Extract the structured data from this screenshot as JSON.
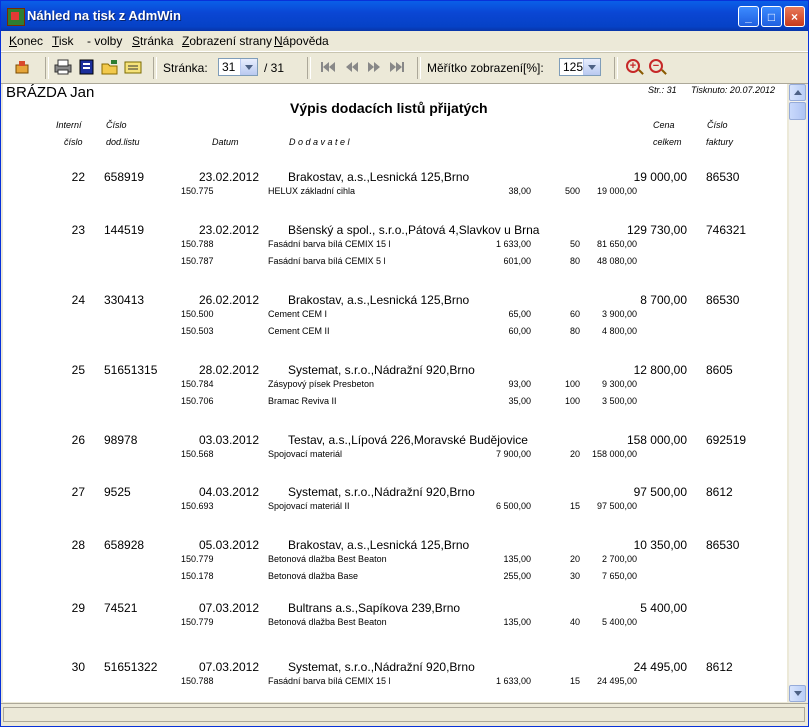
{
  "window": {
    "title": "Náhled na tisk z AdmWin"
  },
  "menu": [
    {
      "label": "Konec"
    },
    {
      "label": "Tisk"
    },
    {
      "label": "- volby"
    },
    {
      "label": "Stránka"
    },
    {
      "label": "Zobrazení strany"
    },
    {
      "label": "Nápověda"
    }
  ],
  "toolbar": {
    "page_label": "Stránka:",
    "page_value": "31",
    "page_total": "/ 31",
    "scale_label": "Měřítko zobrazení[%]:",
    "scale_value": "125"
  },
  "report": {
    "company": "BRÁZDA Jan",
    "page_info": "Str.: 31",
    "print_info": "Tisknuto: 20.07.2012",
    "title": "Výpis dodacích listů přijatých",
    "headers": {
      "int1": "Interní",
      "int2": "číslo",
      "dl1": "Číslo",
      "dl2": "dod.listu",
      "date": "Datum",
      "supplier": "D o d a v a t e l",
      "cena1": "Cena",
      "cena2": "celkem",
      "fa1": "Číslo",
      "fa2": "faktury"
    },
    "entries": [
      {
        "num": "22",
        "dl": "658919",
        "date": "23.02.2012",
        "supplier": "Brakostav, a.s.,Lesnická 125,Brno",
        "total": "19 000,00",
        "invoice": "86530",
        "items": [
          {
            "code": "150.775",
            "name": "HELUX základní cihla",
            "price": "38,00",
            "qty": "500",
            "sum": "19 000,00"
          }
        ]
      },
      {
        "num": "23",
        "dl": "144519",
        "date": "23.02.2012",
        "supplier": "Bšenský a spol., s.r.o.,Pátová 4,Slavkov u Brna",
        "total": "129 730,00",
        "invoice": "746321",
        "items": [
          {
            "code": "150.788",
            "name": "Fasádní barva bílá CEMIX 15 l",
            "price": "1 633,00",
            "qty": "50",
            "sum": "81 650,00"
          },
          {
            "code": "150.787",
            "name": "Fasádní barva bílá CEMIX 5 l",
            "price": "601,00",
            "qty": "80",
            "sum": "48 080,00"
          }
        ]
      },
      {
        "num": "24",
        "dl": "330413",
        "date": "26.02.2012",
        "supplier": "Brakostav, a.s.,Lesnická 125,Brno",
        "total": "8 700,00",
        "invoice": "86530",
        "items": [
          {
            "code": "150.500",
            "name": "Cement CEM I",
            "price": "65,00",
            "qty": "60",
            "sum": "3 900,00"
          },
          {
            "code": "150.503",
            "name": "Cement CEM II",
            "price": "60,00",
            "qty": "80",
            "sum": "4 800,00"
          }
        ]
      },
      {
        "num": "25",
        "dl": "51651315",
        "date": "28.02.2012",
        "supplier": "Systemat, s.r.o.,Nádražní 920,Brno",
        "total": "12 800,00",
        "invoice": "8605",
        "items": [
          {
            "code": "150.784",
            "name": "Zásypový písek Presbeton",
            "price": "93,00",
            "qty": "100",
            "sum": "9 300,00"
          },
          {
            "code": "150.706",
            "name": "Bramac Reviva II",
            "price": "35,00",
            "qty": "100",
            "sum": "3 500,00"
          }
        ]
      },
      {
        "num": "26",
        "dl": "98978",
        "date": "03.03.2012",
        "supplier": "Testav, a.s.,Lípová 226,Moravské Budějovice",
        "total": "158 000,00",
        "invoice": "692519",
        "items": [
          {
            "code": "150.568",
            "name": "Spojovací materiál",
            "price": "7 900,00",
            "qty": "20",
            "sum": "158 000,00"
          }
        ]
      },
      {
        "num": "27",
        "dl": "9525",
        "date": "04.03.2012",
        "supplier": "Systemat, s.r.o.,Nádražní 920,Brno",
        "total": "97 500,00",
        "invoice": "8612",
        "items": [
          {
            "code": "150.693",
            "name": "Spojovací materiál II",
            "price": "6 500,00",
            "qty": "15",
            "sum": "97 500,00"
          }
        ]
      },
      {
        "num": "28",
        "dl": "658928",
        "date": "05.03.2012",
        "supplier": "Brakostav, a.s.,Lesnická 125,Brno",
        "total": "10 350,00",
        "invoice": "86530",
        "items": [
          {
            "code": "150.779",
            "name": "Betonová dlažba Best Beaton",
            "price": "135,00",
            "qty": "20",
            "sum": "2 700,00"
          },
          {
            "code": "150.178",
            "name": "Betonová dlažba Base",
            "price": "255,00",
            "qty": "30",
            "sum": "7 650,00"
          }
        ]
      },
      {
        "num": "29",
        "dl": "74521",
        "date": "07.03.2012",
        "supplier": "Bultrans a.s.,Sapíkova 239,Brno",
        "total": "5 400,00",
        "invoice": "",
        "items": [
          {
            "code": "150.779",
            "name": "Betonová dlažba Best Beaton",
            "price": "135,00",
            "qty": "40",
            "sum": "5 400,00"
          }
        ]
      },
      {
        "num": "30",
        "dl": "51651322",
        "date": "07.03.2012",
        "supplier": "Systemat, s.r.o.,Nádražní 920,Brno",
        "total": "24 495,00",
        "invoice": "8612",
        "items": [
          {
            "code": "150.788",
            "name": "Fasádní barva bílá CEMIX 15 l",
            "price": "1 633,00",
            "qty": "15",
            "sum": "24 495,00"
          }
        ]
      }
    ]
  }
}
